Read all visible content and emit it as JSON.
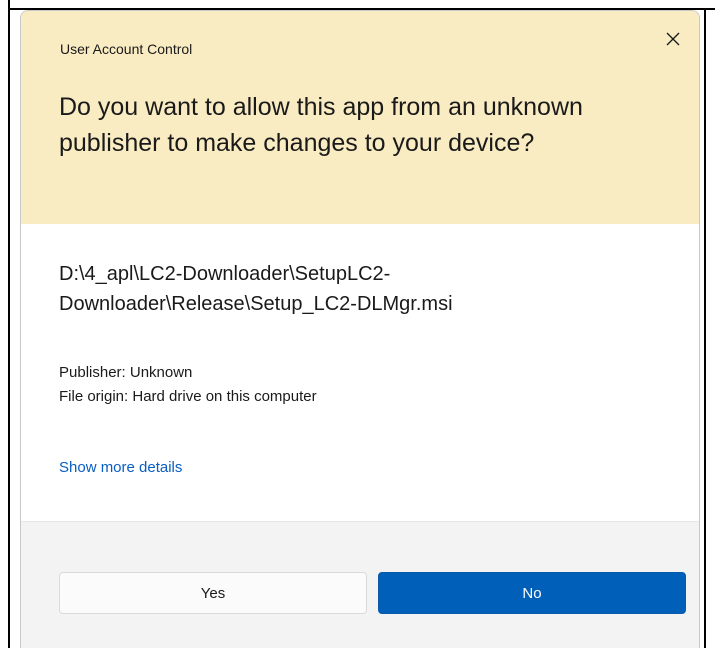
{
  "dialog": {
    "title": "User Account Control",
    "question": "Do you want to allow this app from an unknown publisher to make changes to your device?",
    "app_path": "D:\\4_apl\\LC2-Downloader\\SetupLC2-Downloader\\Release\\Setup_LC2-DLMgr.msi",
    "publisher": "Publisher: Unknown",
    "file_origin": "File origin: Hard drive on this computer",
    "more_details_link": "Show more details",
    "close_icon": "close-icon",
    "buttons": {
      "yes": "Yes",
      "no": "No"
    },
    "colors": {
      "header_bg": "#f9ebc2",
      "primary_button": "#005fb8",
      "link": "#0a5ec2",
      "footer_bg": "#f3f3f3"
    }
  }
}
